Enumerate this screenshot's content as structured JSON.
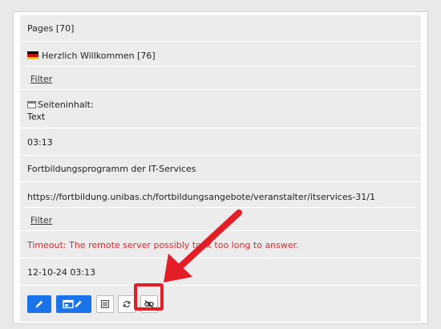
{
  "pages_header": "Pages [70]",
  "page_item": {
    "flag": "germany-flag-icon",
    "title": "Herzlich Willkommen [76]"
  },
  "filter_link_1": "Filter",
  "content": {
    "label": "Seiteninhalt:",
    "type": "Text"
  },
  "time_short": "03:13",
  "program_title": "Fortbildungsprogramm der IT-Services",
  "url": "https://fortbildung.unibas.ch/fortbildungsangebote/veranstalter/itservices-31/1",
  "filter_link_2": "Filter",
  "timeout_message": "Timeout: The remote server possibly took too long to answer.",
  "datetime": "12-10-24 03:13",
  "toolbar": {
    "edit_icon": "pencil-icon",
    "edit_content_icon": "edit-content-icon",
    "list_icon": "list-icon",
    "refresh_icon": "refresh-icon",
    "disable_link_icon": "disable-link-icon"
  },
  "colors": {
    "accent_blue": "#1a73e8",
    "error_red": "#e0262b",
    "annotation_red": "#e41e26"
  }
}
